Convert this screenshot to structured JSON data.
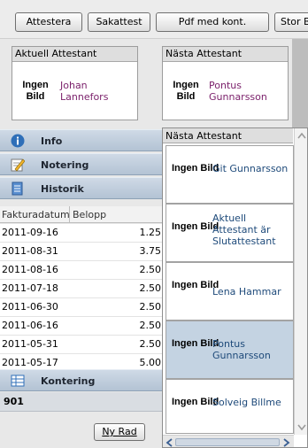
{
  "toolbar": {
    "attestera": "Attestera",
    "sakattest": "Sakattest",
    "pdf": "Pdf med kont.",
    "stor": "Stor B"
  },
  "current_attestant": {
    "header": "Aktuell Attestant",
    "no_image": "Ingen Bild",
    "name": "Johan Lannefors"
  },
  "next_attestant": {
    "header": "Nästa Attestant",
    "no_image": "Ingen Bild",
    "name": "Pontus Gunnarsson"
  },
  "accordion": {
    "info": "Info",
    "notering": "Notering",
    "historik": "Historik",
    "kontering": "Kontering"
  },
  "history_table": {
    "columns": [
      "Fakturadatum",
      "Belopp"
    ],
    "rows": [
      {
        "date": "2011-09-16",
        "amount": "1.25"
      },
      {
        "date": "2011-08-31",
        "amount": "3.75"
      },
      {
        "date": "2011-08-16",
        "amount": "2.50"
      },
      {
        "date": "2011-07-18",
        "amount": "2.50"
      },
      {
        "date": "2011-06-30",
        "amount": "2.50"
      },
      {
        "date": "2011-06-16",
        "amount": "2.50"
      },
      {
        "date": "2011-05-31",
        "amount": "2.50"
      },
      {
        "date": "2011-05-17",
        "amount": "5.00"
      }
    ]
  },
  "kontering_value": "901",
  "ny_rad_button": "Ny Rad",
  "dropdown": {
    "header": "Nästa Attestant",
    "no_image": "Ingen Bild",
    "options": [
      {
        "name": "Git Gunnarsson",
        "selected": false
      },
      {
        "name": "Aktuell Attestant är Slutattestant",
        "selected": false
      },
      {
        "name": "Lena Hammar",
        "selected": false
      },
      {
        "name": "Pontus Gunnarsson",
        "selected": true
      },
      {
        "name": "Solveig Billme",
        "selected": false
      }
    ]
  },
  "colors": {
    "accordion_bg": "#c0cedd",
    "selected_option": "#c4d3e2",
    "name_text": "#7a1f6a"
  }
}
